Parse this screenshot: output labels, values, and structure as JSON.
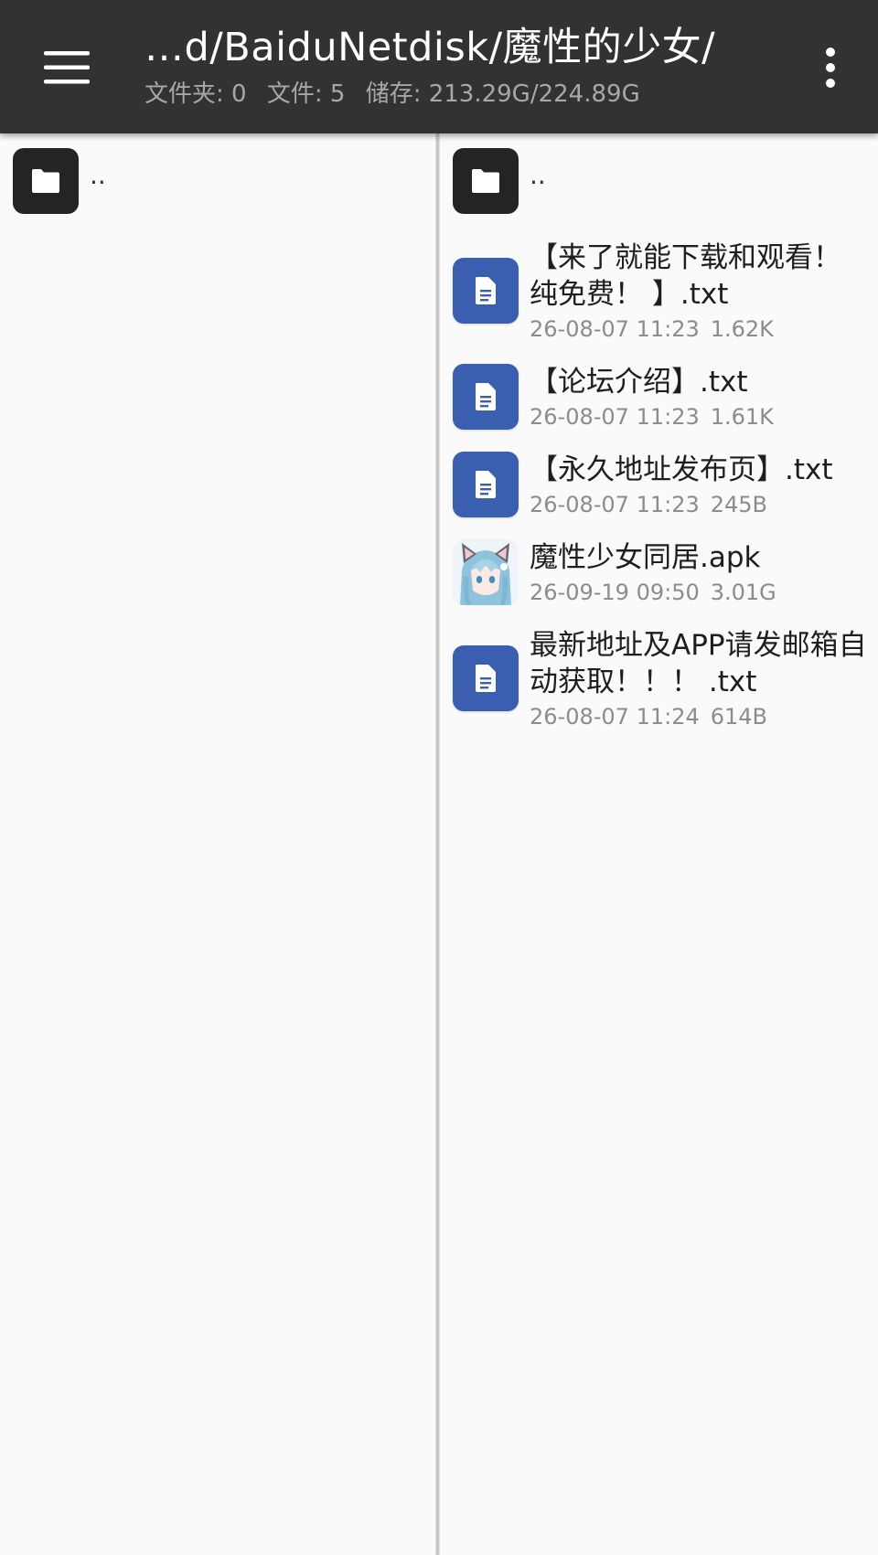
{
  "appbar": {
    "path": "…d/BaiduNetdisk/魔性的少女/",
    "folders_label": "文件夹: 0",
    "files_label": "文件: 5",
    "storage_label": "储存: 213.29G/224.89G"
  },
  "left_pane": {
    "up_label": ".."
  },
  "right_pane": {
    "up_label": "..",
    "files": [
      {
        "name": "【来了就能下载和观看！ 纯免费！ 】.txt",
        "date": "26-08-07 11:23",
        "size": "1.62K",
        "icon": "text-file-icon"
      },
      {
        "name": "【论坛介绍】.txt",
        "date": "26-08-07 11:23",
        "size": "1.61K",
        "icon": "text-file-icon"
      },
      {
        "name": "【永久地址发布页】.txt",
        "date": "26-08-07 11:23",
        "size": "245B",
        "icon": "text-file-icon"
      },
      {
        "name": "魔性少女同居.apk",
        "date": "26-09-19 09:50",
        "size": "3.01G",
        "icon": "app-thumbnail-icon"
      },
      {
        "name": "最新地址及APP请发邮箱自动获取！！！ .txt",
        "date": "26-08-07 11:24",
        "size": "614B",
        "icon": "text-file-icon"
      }
    ]
  },
  "colors": {
    "appbar_bg": "#323232",
    "text_file_icon_bg": "#3a5fb0",
    "folder_icon_bg": "#242424",
    "pane_bg": "#fafafa"
  }
}
